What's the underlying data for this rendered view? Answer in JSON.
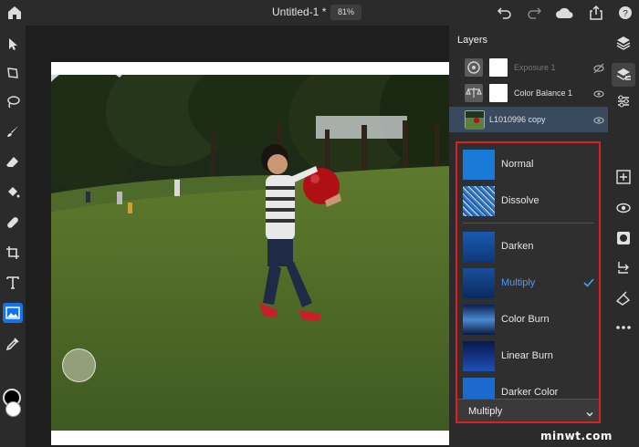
{
  "header": {
    "doc_title": "Untitled-1 *",
    "zoom": "81%",
    "icons": [
      "home-icon",
      "undo-icon",
      "redo-icon",
      "cloud-icon",
      "share-icon",
      "help-icon"
    ]
  },
  "tools": [
    "move-icon",
    "transform-icon",
    "lasso-icon",
    "brush-icon",
    "eraser-icon",
    "paint-bucket-icon",
    "healing-brush-icon",
    "crop-icon",
    "type-icon",
    "place-image-icon",
    "eyedropper-icon"
  ],
  "colors": {
    "foreground": "#000000",
    "background": "#ffffff",
    "accent": "#1473e6",
    "highlight_border": "#e02020"
  },
  "layers": {
    "title": "Layers",
    "items": [
      {
        "name": "Exposure 1",
        "visible": false,
        "icon": "exposure-icon"
      },
      {
        "name": "Color Balance 1",
        "visible": true,
        "icon": "color-balance-icon"
      },
      {
        "name": "L1010996 copy",
        "visible": true,
        "icon": "photo-thumbnail"
      }
    ]
  },
  "blend_modes": {
    "options": [
      "Normal",
      "Dissolve",
      "Darken",
      "Multiply",
      "Color Burn",
      "Linear Burn",
      "Darker Color"
    ],
    "selected": "Multiply",
    "selected_label": "Multiply"
  },
  "right_rail": [
    "layers-icon",
    "layer-properties-icon",
    "adjustments-icon",
    "add-layer-icon",
    "visibility-icon",
    "mask-icon",
    "clip-icon",
    "fill-icon",
    "more-icon"
  ],
  "watermark": "minwt.com"
}
